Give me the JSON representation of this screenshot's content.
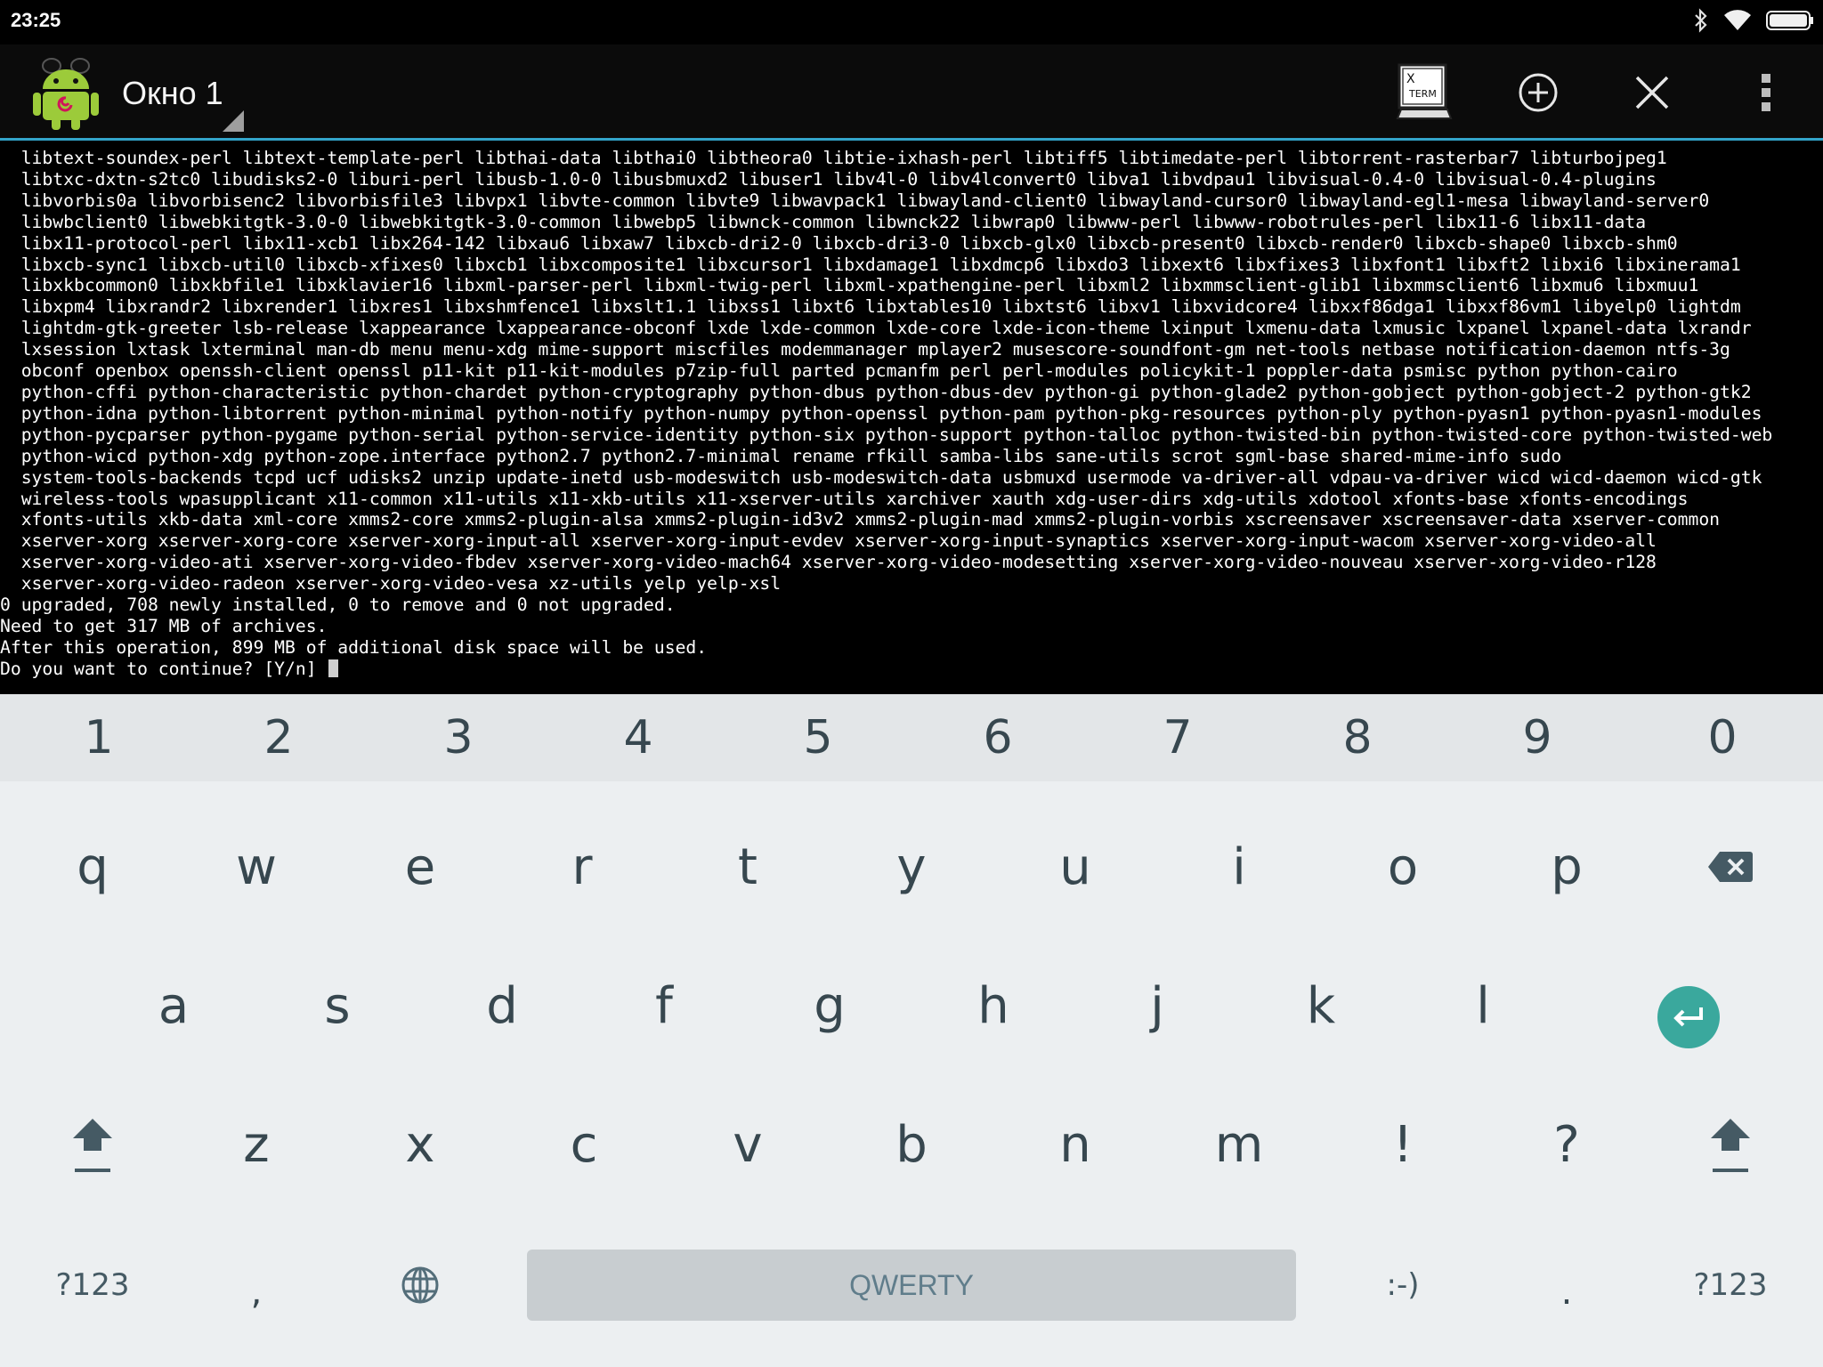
{
  "status_bar": {
    "time": "23:25",
    "icons": [
      "bluetooth-icon",
      "wifi-icon",
      "battery-icon"
    ]
  },
  "action_bar": {
    "app_icon": "android-debian-icon",
    "window_title": "Окно 1",
    "buttons": [
      {
        "name": "xterm-button",
        "icon_text_top": "X",
        "icon_text_bottom": "TERM"
      },
      {
        "name": "add-window-button",
        "icon": "plus-circle-icon"
      },
      {
        "name": "close-window-button",
        "icon": "close-icon"
      },
      {
        "name": "overflow-menu-button",
        "icon": "more-vert-icon"
      }
    ],
    "accent_color": "#33a4c9"
  },
  "terminal": {
    "lines": [
      "  libtext-soundex-perl libtext-template-perl libthai-data libthai0 libtheora0 libtie-ixhash-perl libtiff5 libtimedate-perl libtorrent-rasterbar7 libturbojpeg1",
      "  libtxc-dxtn-s2tc0 libudisks2-0 liburi-perl libusb-1.0-0 libusbmuxd2 libuser1 libv4l-0 libv4lconvert0 libva1 libvdpau1 libvisual-0.4-0 libvisual-0.4-plugins",
      "  libvorbis0a libvorbisenc2 libvorbisfile3 libvpx1 libvte-common libvte9 libwavpack1 libwayland-client0 libwayland-cursor0 libwayland-egl1-mesa libwayland-server0",
      "  libwbclient0 libwebkitgtk-3.0-0 libwebkitgtk-3.0-common libwebp5 libwnck-common libwnck22 libwrap0 libwww-perl libwww-robotrules-perl libx11-6 libx11-data",
      "  libx11-protocol-perl libx11-xcb1 libx264-142 libxau6 libxaw7 libxcb-dri2-0 libxcb-dri3-0 libxcb-glx0 libxcb-present0 libxcb-render0 libxcb-shape0 libxcb-shm0",
      "  libxcb-sync1 libxcb-util0 libxcb-xfixes0 libxcb1 libxcomposite1 libxcursor1 libxdamage1 libxdmcp6 libxdo3 libxext6 libxfixes3 libxfont1 libxft2 libxi6 libxinerama1",
      "  libxkbcommon0 libxkbfile1 libxklavier16 libxml-parser-perl libxml-twig-perl libxml-xpathengine-perl libxml2 libxmmsclient-glib1 libxmmsclient6 libxmu6 libxmuu1",
      "  libxpm4 libxrandr2 libxrender1 libxres1 libxshmfence1 libxslt1.1 libxss1 libxt6 libxtables10 libxtst6 libxv1 libxvidcore4 libxxf86dga1 libxxf86vm1 libyelp0 lightdm",
      "  lightdm-gtk-greeter lsb-release lxappearance lxappearance-obconf lxde lxde-common lxde-core lxde-icon-theme lxinput lxmenu-data lxmusic lxpanel lxpanel-data lxrandr",
      "  lxsession lxtask lxterminal man-db menu menu-xdg mime-support miscfiles modemmanager mplayer2 musescore-soundfont-gm net-tools netbase notification-daemon ntfs-3g",
      "  obconf openbox openssh-client openssl p11-kit p11-kit-modules p7zip-full parted pcmanfm perl perl-modules policykit-1 poppler-data psmisc python python-cairo",
      "  python-cffi python-characteristic python-chardet python-cryptography python-dbus python-dbus-dev python-gi python-glade2 python-gobject python-gobject-2 python-gtk2",
      "  python-idna python-libtorrent python-minimal python-notify python-numpy python-openssl python-pam python-pkg-resources python-ply python-pyasn1 python-pyasn1-modules",
      "  python-pycparser python-pygame python-serial python-service-identity python-six python-support python-talloc python-twisted-bin python-twisted-core python-twisted-web",
      "  python-wicd python-xdg python-zope.interface python2.7 python2.7-minimal rename rfkill samba-libs sane-utils scrot sgml-base shared-mime-info sudo",
      "  system-tools-backends tcpd ucf udisks2 unzip update-inetd usb-modeswitch usb-modeswitch-data usbmuxd usermode va-driver-all vdpau-va-driver wicd wicd-daemon wicd-gtk",
      "  wireless-tools wpasupplicant x11-common x11-utils x11-xkb-utils x11-xserver-utils xarchiver xauth xdg-user-dirs xdg-utils xdotool xfonts-base xfonts-encodings",
      "  xfonts-utils xkb-data xml-core xmms2-core xmms2-plugin-alsa xmms2-plugin-id3v2 xmms2-plugin-mad xmms2-plugin-vorbis xscreensaver xscreensaver-data xserver-common",
      "  xserver-xorg xserver-xorg-core xserver-xorg-input-all xserver-xorg-input-evdev xserver-xorg-input-synaptics xserver-xorg-input-wacom xserver-xorg-video-all",
      "  xserver-xorg-video-ati xserver-xorg-video-fbdev xserver-xorg-video-mach64 xserver-xorg-video-modesetting xserver-xorg-video-nouveau xserver-xorg-video-r128",
      "  xserver-xorg-video-radeon xserver-xorg-video-vesa xz-utils yelp yelp-xsl",
      "0 upgraded, 708 newly installed, 0 to remove and 0 not upgraded.",
      "Need to get 317 MB of archives.",
      "After this operation, 899 MB of additional disk space will be used."
    ],
    "prompt": "Do you want to continue? [Y/n] "
  },
  "keyboard": {
    "number_row": [
      "1",
      "2",
      "3",
      "4",
      "5",
      "6",
      "7",
      "8",
      "9",
      "0"
    ],
    "row1": [
      "q",
      "w",
      "e",
      "r",
      "t",
      "y",
      "u",
      "i",
      "o",
      "p"
    ],
    "row2": [
      "a",
      "s",
      "d",
      "f",
      "g",
      "h",
      "j",
      "k",
      "l"
    ],
    "row3": [
      "z",
      "x",
      "c",
      "v",
      "b",
      "n",
      "m",
      "!",
      "?"
    ],
    "symbols_left": "?123",
    "comma": ",",
    "space_label": "QWERTY",
    "smiley": ":-)",
    "period": ".",
    "symbols_right": "?123",
    "enter_color": "#3aa89d"
  }
}
